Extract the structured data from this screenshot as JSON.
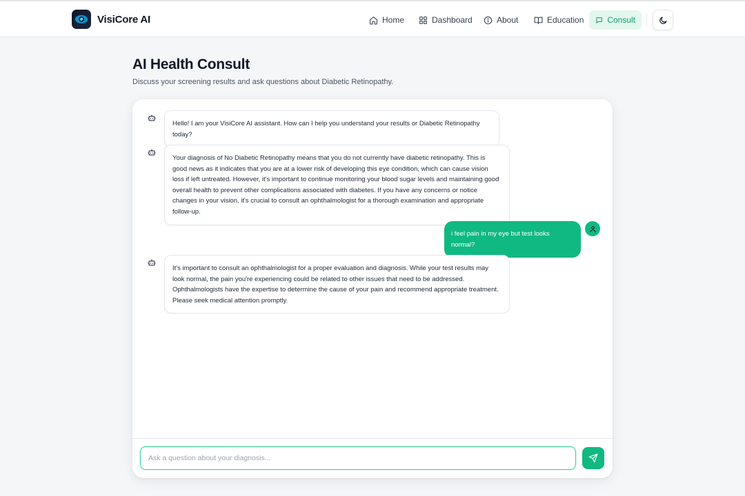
{
  "brand": {
    "name": "VisiCore AI"
  },
  "nav": {
    "items": [
      {
        "label": "Home",
        "icon": "home-icon"
      },
      {
        "label": "Dashboard",
        "icon": "grid-icon"
      },
      {
        "label": "About",
        "icon": "info-icon"
      },
      {
        "label": "Education",
        "icon": "book-icon"
      },
      {
        "label": "Consult",
        "icon": "chat-icon",
        "active": true
      }
    ],
    "theme_toggle_icon": "moon-icon"
  },
  "page": {
    "title": "AI Health Consult",
    "subtitle": "Discuss your screening results and ask questions about Diabetic Retinopathy."
  },
  "messages": [
    {
      "role": "bot",
      "text": "Hello! I am your VisiCore AI assistant. How can I help you understand your results or Diabetic Retinopathy today?"
    },
    {
      "role": "bot",
      "text": "Your diagnosis of No Diabetic Retinopathy means that you do not currently have diabetic retinopathy. This is good news as it indicates that you are at a lower risk of developing this eye condition, which can cause vision loss if left untreated. However, it's important to continue monitoring your blood sugar levels and maintaining good overall health to prevent other complications associated with diabetes. If you have any concerns or notice changes in your vision, it's crucial to consult an ophthalmologist for a thorough examination and appropriate follow-up."
    },
    {
      "role": "user",
      "text": "i feel pain in my eye but test looks normal?"
    },
    {
      "role": "bot",
      "text": "It's important to consult an ophthalmologist for a proper evaluation and diagnosis. While your test results may look normal, the pain you're experiencing could be related to other issues that need to be addressed. Ophthalmologists have the expertise to determine the cause of your pain and recommend appropriate treatment. Please seek medical attention promptly."
    }
  ],
  "input": {
    "value": "",
    "placeholder": "Ask a question about your diagnosis..."
  },
  "colors": {
    "accent": "#10b981",
    "accent_light": "#e3f7ef",
    "text": "#111827"
  }
}
